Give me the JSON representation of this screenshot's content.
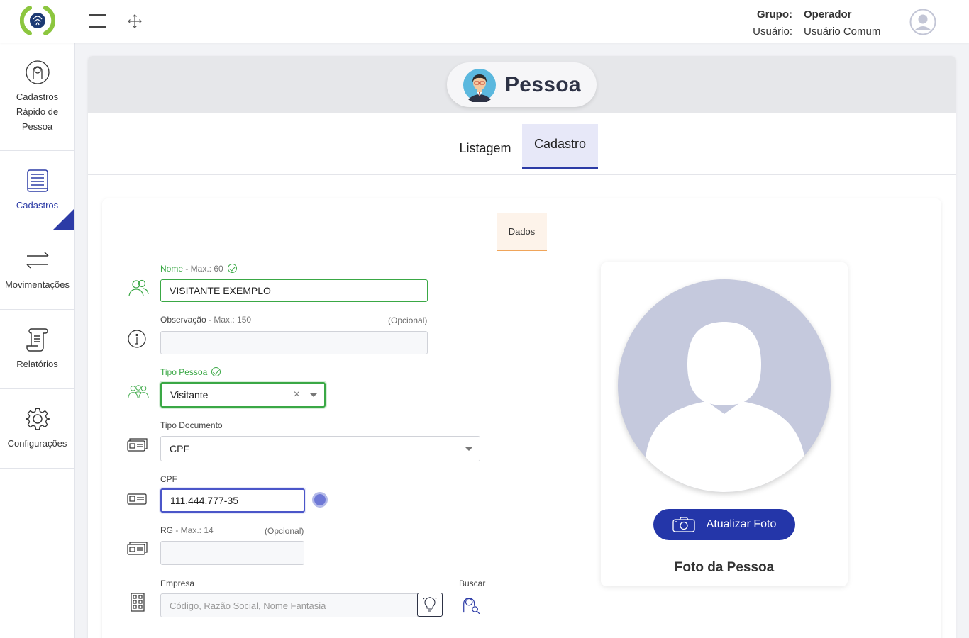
{
  "header": {
    "grupo_label": "Grupo:",
    "grupo_value": "Operador",
    "usuario_label": "Usuário:",
    "usuario_value": "Usuário Comum"
  },
  "sidebar": {
    "items": [
      {
        "label": "Cadastros Rápido de Pessoa",
        "icon": "user-circle-icon"
      },
      {
        "label": "Cadastros",
        "icon": "register-list-icon",
        "active": true
      },
      {
        "label": "Movimentações",
        "icon": "transfer-arrows-icon"
      },
      {
        "label": "Relatórios",
        "icon": "report-scroll-icon"
      },
      {
        "label": "Configurações",
        "icon": "gear-icon"
      }
    ]
  },
  "page": {
    "title": "Pessoa",
    "tabs": [
      {
        "label": "Listagem"
      },
      {
        "label": "Cadastro",
        "active": true
      }
    ],
    "subtab": "Dados"
  },
  "form": {
    "nome": {
      "label": "Nome",
      "hint": " - Max.: 60",
      "value": "VISITANTE EXEMPLO"
    },
    "observacao": {
      "label": "Observação",
      "hint": " - Max.: 150",
      "optional": "(Opcional)",
      "value": ""
    },
    "tipo_pessoa": {
      "label": "Tipo Pessoa",
      "value": "Visitante",
      "clear": "×"
    },
    "tipo_documento": {
      "label": "Tipo Documento",
      "value": "CPF"
    },
    "cpf": {
      "label": "CPF",
      "value": "111.444.777-35"
    },
    "rg": {
      "label": "RG",
      "hint": " - Max.: 14",
      "optional": "(Opcional)",
      "value": ""
    },
    "empresa": {
      "label": "Empresa",
      "placeholder": "Código, Razão Social, Nome Fantasia",
      "search_label": "Buscar"
    }
  },
  "photo": {
    "button_label": "Atualizar Foto",
    "caption": "Foto da Pessoa"
  },
  "colors": {
    "accent": "#2c3ba6",
    "valid_green": "#3aa845",
    "subtab_orange": "#f0a55a",
    "logo_green": "#8cc63f"
  }
}
